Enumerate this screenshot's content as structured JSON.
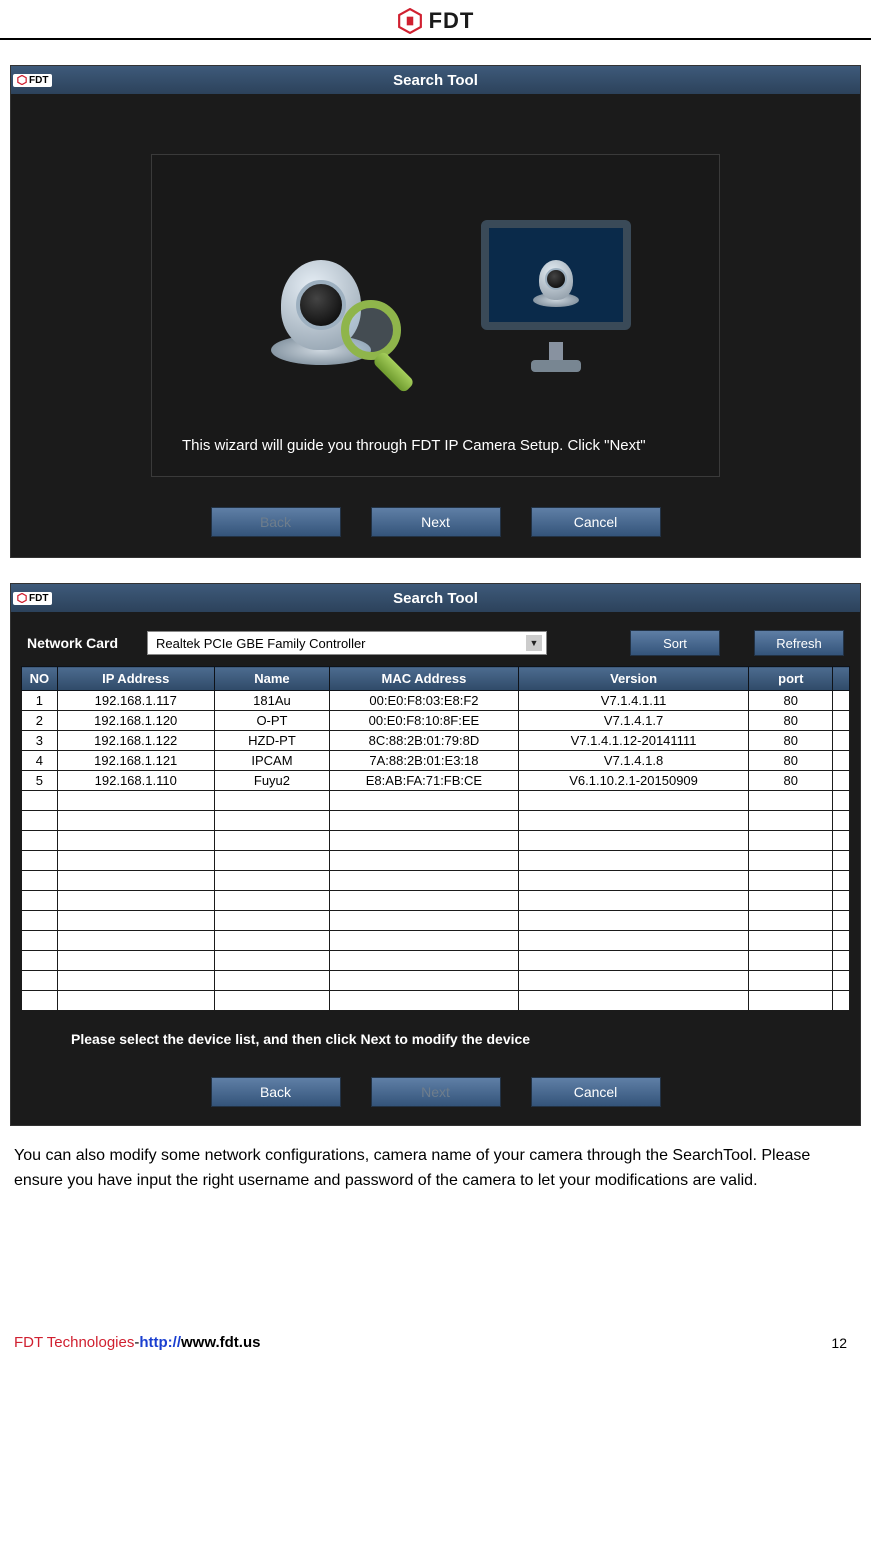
{
  "header": {
    "brand": "FDT"
  },
  "wizard1": {
    "titlebar_brand": "FDT",
    "title": "Search Tool",
    "message": "This wizard will guide you through FDT IP Camera Setup. Click \"Next\"",
    "buttons": {
      "back": "Back",
      "next": "Next",
      "cancel": "Cancel"
    }
  },
  "wizard2": {
    "titlebar_brand": "FDT",
    "title": "Search Tool",
    "network_card_label": "Network Card",
    "network_card_value": "Realtek PCIe GBE Family Controller",
    "sort_btn": "Sort",
    "refresh_btn": "Refresh",
    "columns": {
      "no": "NO",
      "ip": "IP Address",
      "name": "Name",
      "mac": "MAC Address",
      "version": "Version",
      "port": "port"
    },
    "rows": [
      {
        "no": "1",
        "ip": "192.168.1.117",
        "name": "181Au",
        "mac": "00:E0:F8:03:E8:F2",
        "version": "V7.1.4.1.11",
        "port": "80"
      },
      {
        "no": "2",
        "ip": "192.168.1.120",
        "name": "O-PT",
        "mac": "00:E0:F8:10:8F:EE",
        "version": "V7.1.4.1.7",
        "port": "80"
      },
      {
        "no": "3",
        "ip": "192.168.1.122",
        "name": "HZD-PT",
        "mac": "8C:88:2B:01:79:8D",
        "version": "V7.1.4.1.12-20141111",
        "port": "80"
      },
      {
        "no": "4",
        "ip": "192.168.1.121",
        "name": "IPCAM",
        "mac": "7A:88:2B:01:E3:18",
        "version": "V7.1.4.1.8",
        "port": "80"
      },
      {
        "no": "5",
        "ip": "192.168.1.110",
        "name": "Fuyu2",
        "mac": "E8:AB:FA:71:FB:CE",
        "version": "V6.1.10.2.1-20150909",
        "port": "80"
      }
    ],
    "empty_row_count": 11,
    "instruction": "Please select the device list, and then click Next to modify the device",
    "buttons": {
      "back": "Back",
      "next": "Next",
      "cancel": "Cancel"
    }
  },
  "body_paragraph": "You can also modify some network configurations, camera name of your camera through the SearchTool. Please ensure you have input the right username and password of the camera to let your modifications are valid.",
  "footer": {
    "company": "FDT Technologies",
    "dash": "-",
    "url_scheme": "http://",
    "url_host": "www.fdt.us",
    "page_number": "12"
  }
}
